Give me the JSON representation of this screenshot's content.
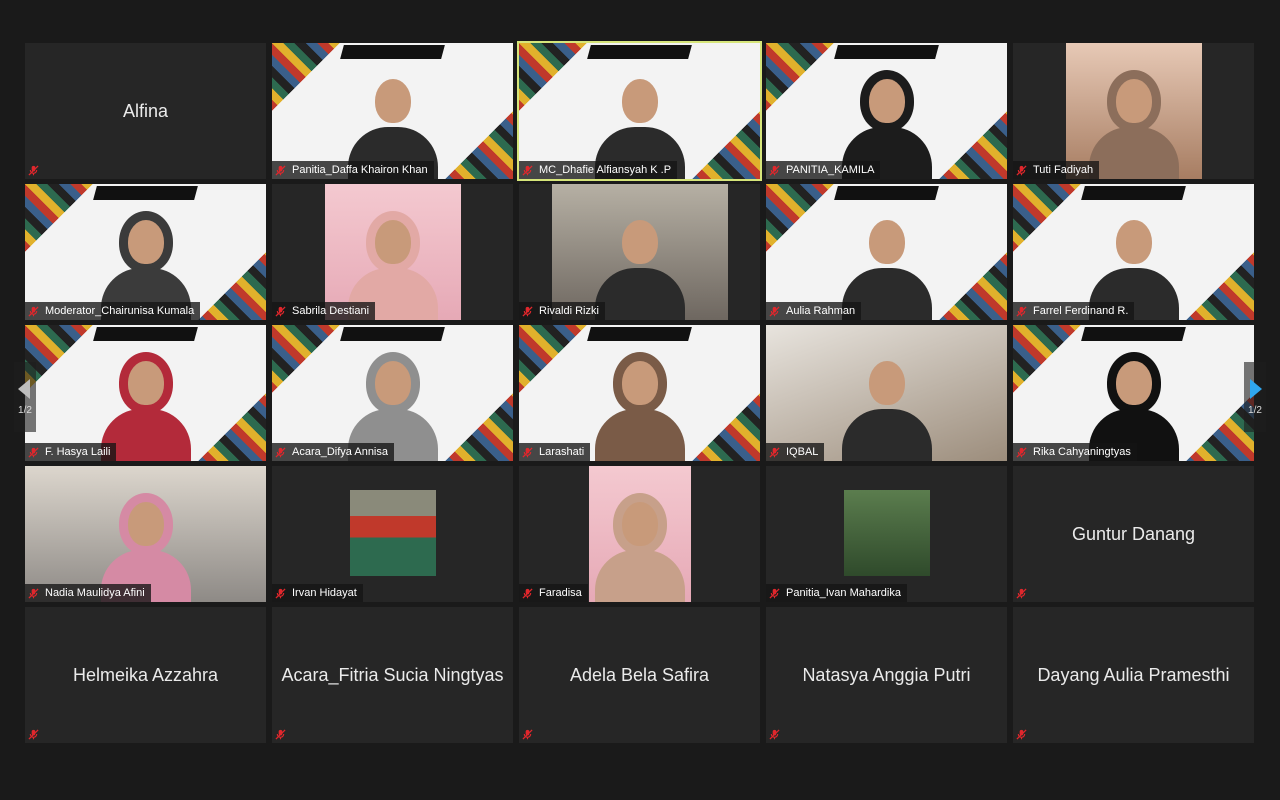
{
  "participants": [
    {
      "name": "Alfina",
      "video": false
    },
    {
      "name": "Panitia_Daffa Khairon Khan",
      "video": true,
      "bg": "bg-hero",
      "hijab": false
    },
    {
      "name": "MC_Dhafie Alfiansyah K .P",
      "video": true,
      "bg": "bg-hero",
      "hijab": false,
      "active": true
    },
    {
      "name": "PANITIA_KAMILA",
      "video": true,
      "bg": "bg-hero",
      "hijab": true,
      "hj": "#1c1c1c"
    },
    {
      "name": "Tuti Fadiyah",
      "video": true,
      "bg": "bg-tuti",
      "inset": "w136",
      "hijab": true,
      "hj": "#8c6e5b"
    },
    {
      "name": "Moderator_Chairunisa Kumala",
      "video": true,
      "bg": "bg-hero",
      "hijab": true,
      "hj": "#3b3b3b"
    },
    {
      "name": "Sabrila Destiani",
      "video": true,
      "bg": "bg-pink",
      "inset": "w136",
      "hijab": true,
      "hj": "#e2a9a5"
    },
    {
      "name": "Rivaldi Rizki",
      "video": true,
      "bg": "bg-room2",
      "inset": "w176",
      "hijab": false
    },
    {
      "name": "Aulia Rahman",
      "video": true,
      "bg": "bg-hero",
      "hijab": false
    },
    {
      "name": "Farrel Ferdinand R.",
      "video": true,
      "bg": "bg-hero",
      "hijab": false
    },
    {
      "name": "F. Hasya Laili",
      "video": true,
      "bg": "bg-hero",
      "hijab": true,
      "hj": "#b32a3a"
    },
    {
      "name": "Acara_Difya Annisa",
      "video": true,
      "bg": "bg-hero",
      "hijab": true,
      "hj": "#8f8f8f"
    },
    {
      "name": "Larashati",
      "video": true,
      "bg": "bg-hero",
      "hijab": true,
      "hj": "#7a5b47"
    },
    {
      "name": "IQBAL",
      "video": true,
      "bg": "bg-room3",
      "hijab": false
    },
    {
      "name": "Rika Cahyaningtyas",
      "video": true,
      "bg": "bg-hero",
      "hijab": true,
      "hj": "#111111"
    },
    {
      "name": "Nadia Maulidya Afini",
      "video": true,
      "bg": "bg-room4",
      "hijab": true,
      "hj": "#d58aa4"
    },
    {
      "name": "Irvan Hidayat",
      "video": true,
      "photo": "irvan"
    },
    {
      "name": "Faradisa",
      "video": true,
      "bg": "bg-pink",
      "inset": "w102",
      "hijab": true,
      "hj": "#c7a08a"
    },
    {
      "name": "Panitia_Ivan Mahardika",
      "video": true,
      "photo": "ivan"
    },
    {
      "name": "Guntur Danang",
      "video": false
    },
    {
      "name": "Helmeika Azzahra",
      "video": false
    },
    {
      "name": "Acara_Fitria Sucia Ningtyas",
      "video": false
    },
    {
      "name": "Adela Bela Safira",
      "video": false
    },
    {
      "name": "Natasya Anggia Putri",
      "video": false
    },
    {
      "name": "Dayang Aulia Pramesthi",
      "video": false
    }
  ],
  "pagination": {
    "left_label": "1/2",
    "right_label": "1/2"
  },
  "colors": {
    "active_speaker": "#d6e57a",
    "mute_icon": "#e0272c",
    "nav_arrow_right": "#2fa6ee",
    "nav_arrow_left": "#bdbdbd"
  },
  "icons": {
    "mute": "microphone-muted-icon",
    "prev": "chevron-left-icon",
    "next": "chevron-right-icon"
  }
}
